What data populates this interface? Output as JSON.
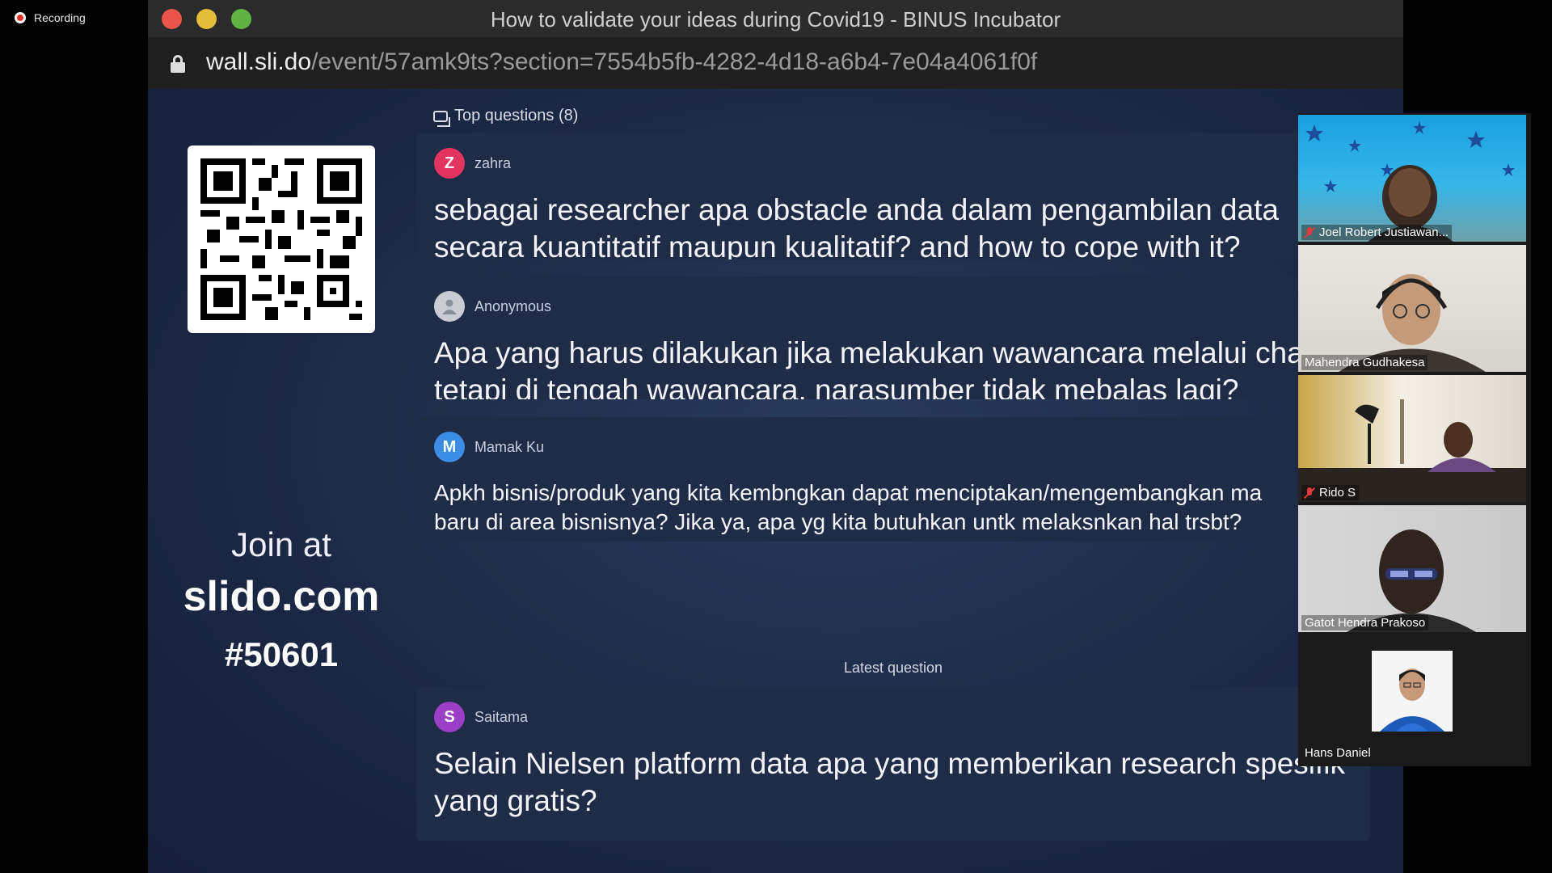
{
  "recording": {
    "label": "Recording"
  },
  "window": {
    "title": "How to validate your ideas during Covid19 - BINUS Incubator"
  },
  "address_bar": {
    "host": "wall.sli.do",
    "path": "/event/57amk9ts?section=7554b5fb-4282-4d18-a6b4-7e04a4061f0f"
  },
  "slido": {
    "join": {
      "line1": "Join at",
      "site": "slido.com",
      "code": "#50601"
    },
    "top_questions_label": "Top questions (8)",
    "latest_label": "Latest question",
    "questions": [
      {
        "author": "zahra",
        "initial": "Z",
        "avatar_color": "#e2345e",
        "line1": "sebagai researcher apa obstacle anda dalam pengambilan data",
        "line2": "secara kuantitatif maupun kualitatif? and how to cope with it?"
      },
      {
        "author": "Anonymous",
        "initial": "",
        "avatar_color": "#c9ccd3",
        "line1": "Apa yang harus dilakukan jika melakukan wawancara melalui cha",
        "line2": "tetapi di tengah wawancara, narasumber tidak mebalas lagi?"
      },
      {
        "author": "Mamak Ku",
        "initial": "M",
        "avatar_color": "#3b8de3",
        "line1": "Apkh bisnis/produk yang kita kembngkan dapat menciptakan/mengembangkan ma",
        "line2": "baru di area bisnisnya? Jika ya, apa yg kita butuhkan untk melaksnkan hal trsbt?"
      },
      {
        "author": "Saitama",
        "initial": "S",
        "avatar_color": "#9b3fc6",
        "line1": "Selain Nielsen platform data apa yang memberikan research spesifik",
        "line2": "yang gratis?"
      }
    ]
  },
  "participants": [
    {
      "name": "Joel Robert Justiawan...",
      "muted": true
    },
    {
      "name": "Mahendra Gudhakesa",
      "muted": false
    },
    {
      "name": "Rido S",
      "muted": true
    },
    {
      "name": "Gatot Hendra Prakoso",
      "muted": false
    },
    {
      "name": "Hans Daniel",
      "muted": false
    }
  ]
}
